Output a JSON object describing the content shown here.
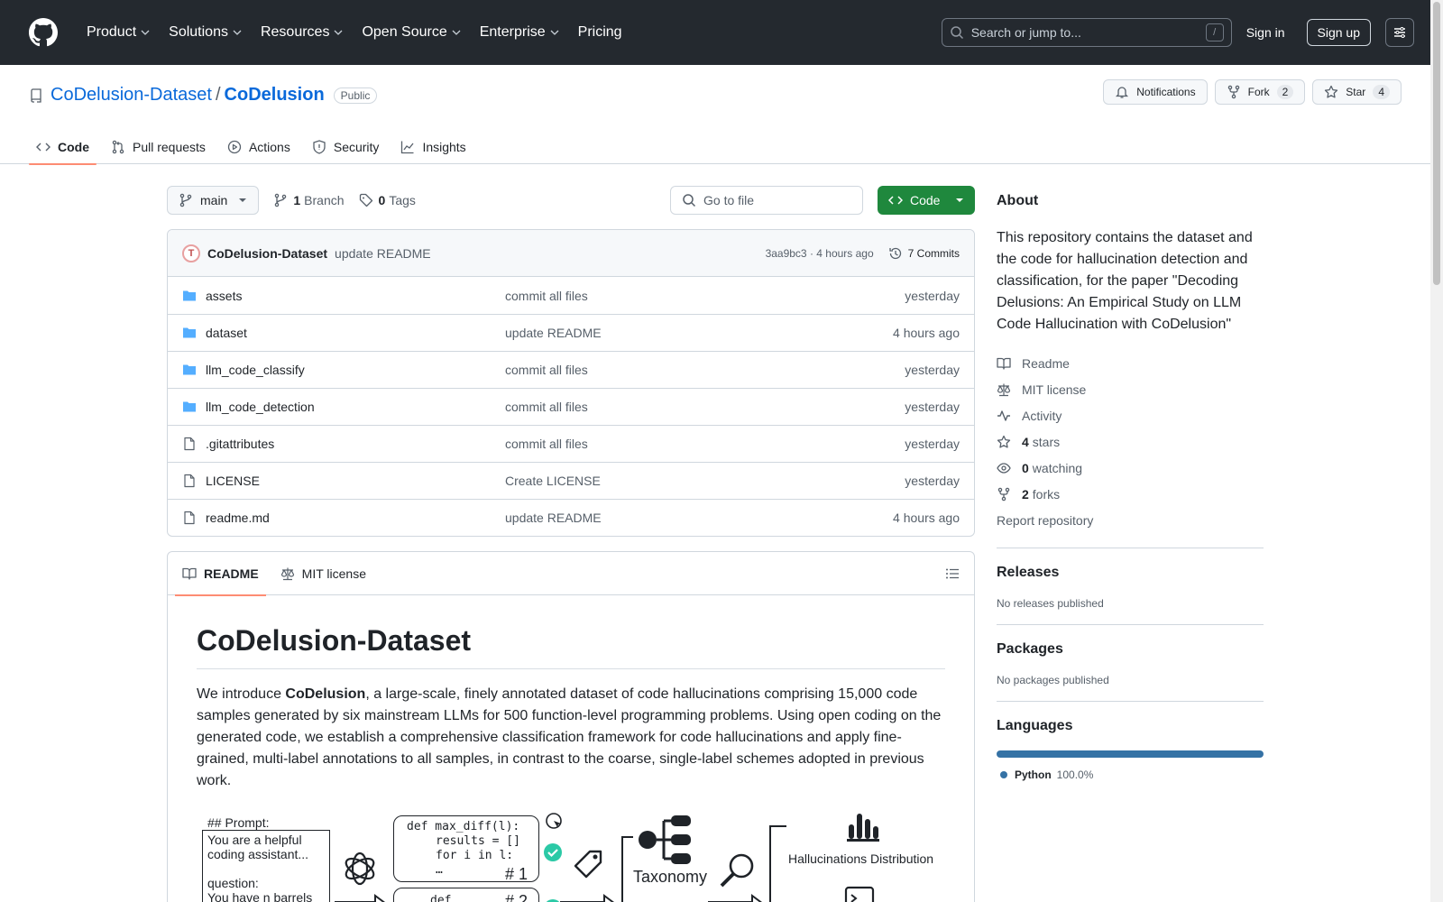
{
  "header": {
    "nav": [
      {
        "label": "Product"
      },
      {
        "label": "Solutions"
      },
      {
        "label": "Resources"
      },
      {
        "label": "Open Source"
      },
      {
        "label": "Enterprise"
      },
      {
        "label": "Pricing"
      }
    ],
    "search_placeholder": "Search or jump to...",
    "search_kbd": "/",
    "sign_in": "Sign in",
    "sign_up": "Sign up"
  },
  "repo": {
    "owner": "CoDelusion-Dataset",
    "sep": "/",
    "name": "CoDelusion",
    "visibility": "Public",
    "notifications": "Notifications",
    "fork_label": "Fork",
    "fork_count": "2",
    "star_label": "Star",
    "star_count": "4"
  },
  "tabs": [
    {
      "label": "Code"
    },
    {
      "label": "Pull requests"
    },
    {
      "label": "Actions"
    },
    {
      "label": "Security"
    },
    {
      "label": "Insights"
    }
  ],
  "toolbar": {
    "branch": "main",
    "branch_count": "1",
    "branch_label": "Branch",
    "tag_count": "0",
    "tag_label": "Tags",
    "goto_placeholder": "Go to file",
    "code_label": "Code"
  },
  "commit": {
    "avatar_letter": "T",
    "author": "CoDelusion-Dataset",
    "message": "update README",
    "meta": "3aa9bc3 · 4 hours ago",
    "commits_label": "7 Commits"
  },
  "files": [
    {
      "name": "assets",
      "type": "folder",
      "msg": "commit all files",
      "time": "yesterday"
    },
    {
      "name": "dataset",
      "type": "folder",
      "msg": "update README",
      "time": "4 hours ago"
    },
    {
      "name": "llm_code_classify",
      "type": "folder",
      "msg": "commit all files",
      "time": "yesterday"
    },
    {
      "name": "llm_code_detection",
      "type": "folder",
      "msg": "commit all files",
      "time": "yesterday"
    },
    {
      "name": ".gitattributes",
      "type": "file",
      "msg": "commit all files",
      "time": "yesterday"
    },
    {
      "name": "LICENSE",
      "type": "file",
      "msg": "Create LICENSE",
      "time": "yesterday"
    },
    {
      "name": "readme.md",
      "type": "file",
      "msg": "update README",
      "time": "4 hours ago"
    }
  ],
  "readme": {
    "tab_readme": "README",
    "tab_license": "MIT license",
    "title": "CoDelusion-Dataset",
    "p_pre": "We introduce ",
    "p_bold": "CoDelusion",
    "p_post": ", a large-scale, finely annotated dataset of code hallucinations comprising 15,000 code samples generated by six mainstream LLMs for 500 function-level programming problems. Using open coding on the generated code, we establish a comprehensive classification framework for code hallucinations and apply fine-grained, multi-label annotations to all samples, in contrast to the coarse, single-label schemes adopted in previous work.",
    "figure": {
      "prompt_title": "## Prompt:",
      "prompt_l1": "You are a helpful",
      "prompt_l2": "coding assistant...",
      "prompt_l3": "question:",
      "prompt_l4": "You have n barrels",
      "code1_l1": "def max_diff(l):",
      "code1_l2": "results = []",
      "code1_l3": "for i in l:",
      "code1_l4": "…",
      "code1_num": "# 1",
      "code2_l1": "def …",
      "code2_num": "# 2",
      "taxonomy": "Taxonomy",
      "distribution": "Hallucinations Distribution"
    }
  },
  "about": {
    "title": "About",
    "description": "This repository contains the dataset and the code for hallucination detection and classification, for the paper \"Decoding Delusions: An Empirical Study on LLM Code Hallucination with CoDelusion\"",
    "readme": "Readme",
    "license": "MIT license",
    "activity": "Activity",
    "stars_count": "4",
    "stars_label": "stars",
    "watching_count": "0",
    "watching_label": "watching",
    "forks_count": "2",
    "forks_label": "forks",
    "report": "Report repository"
  },
  "releases": {
    "title": "Releases",
    "empty": "No releases published"
  },
  "packages": {
    "title": "Packages",
    "empty": "No packages published"
  },
  "languages": {
    "title": "Languages",
    "items": [
      {
        "name": "Python",
        "pct": "100.0%",
        "color": "#3572A5"
      }
    ]
  }
}
